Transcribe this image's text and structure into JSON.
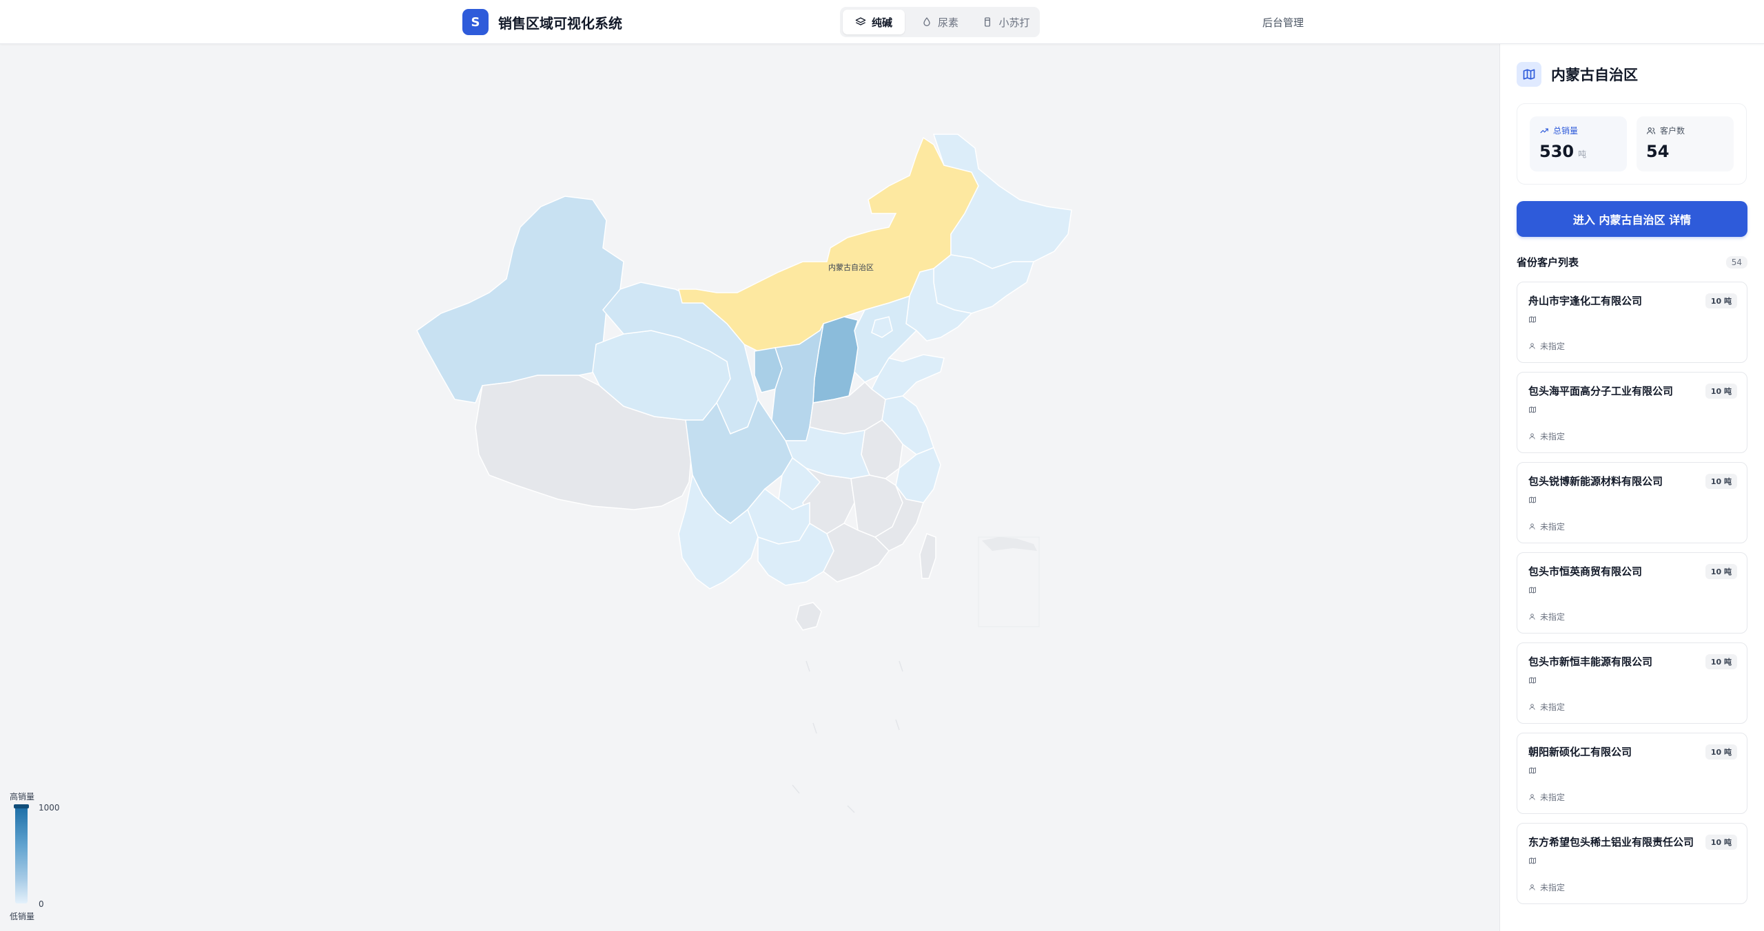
{
  "header": {
    "logo_letter": "S",
    "title": "销售区域可视化系统",
    "tabs": [
      {
        "label": "纯碱",
        "icon": "layers-icon",
        "active": true
      },
      {
        "label": "尿素",
        "icon": "droplet-icon",
        "active": false
      },
      {
        "label": "小苏打",
        "icon": "bottle-icon",
        "active": false
      }
    ],
    "admin_label": "后台管理"
  },
  "map": {
    "selected_region_label": "内蒙古自治区",
    "highlight_color": "#fde8a0",
    "legend": {
      "high_label": "高销量",
      "low_label": "低销量",
      "max_value": "1000",
      "min_value": "0"
    }
  },
  "sidebar": {
    "province_name": "内蒙古自治区",
    "stats": {
      "sales_label": "总销量",
      "sales_value": "530",
      "sales_unit": "吨",
      "customers_label": "客户数",
      "customers_value": "54"
    },
    "enter_button": "进入 内蒙古自治区 详情",
    "list_title": "省份客户列表",
    "list_count": "54",
    "customers": [
      {
        "name": "舟山市宇逢化工有限公司",
        "amount": "10 吨",
        "owner": "未指定"
      },
      {
        "name": "包头海平面高分子工业有限公司",
        "amount": "10 吨",
        "owner": "未指定"
      },
      {
        "name": "包头锐博新能源材料有限公司",
        "amount": "10 吨",
        "owner": "未指定"
      },
      {
        "name": "包头市恒英商贸有限公司",
        "amount": "10 吨",
        "owner": "未指定"
      },
      {
        "name": "包头市新恒丰能源有限公司",
        "amount": "10 吨",
        "owner": "未指定"
      },
      {
        "name": "朝阳新硕化工有限公司",
        "amount": "10 吨",
        "owner": "未指定"
      },
      {
        "name": "东方希望包头稀土铝业有限责任公司",
        "amount": "10 吨",
        "owner": "未指定"
      }
    ]
  }
}
